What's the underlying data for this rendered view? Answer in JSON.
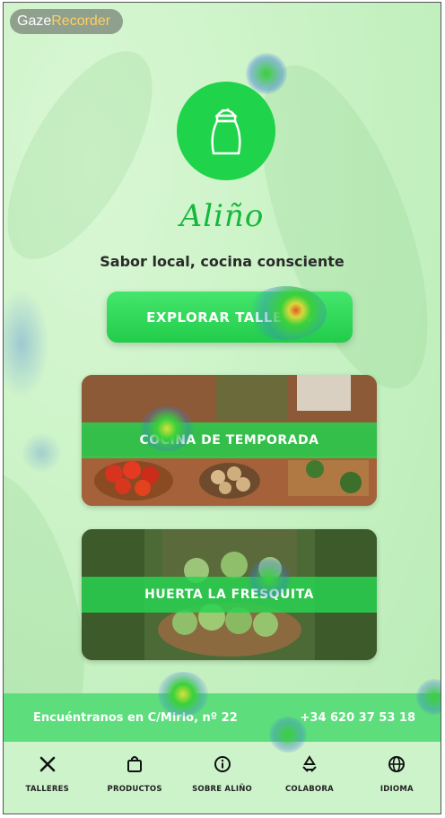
{
  "overlay": {
    "gaze_prefix": "Gaze",
    "gaze_suffix": "Recorder"
  },
  "brand": {
    "name": "Aliño",
    "tagline": "Sabor local, cocina consciente",
    "accent": "#1fd34a"
  },
  "cta": {
    "label": "EXPLORAR TALLERES"
  },
  "cards": [
    {
      "label": "COCINA DE TEMPORADA"
    },
    {
      "label": "HUERTA LA FRESQUITA"
    }
  ],
  "footer": {
    "address": "Encuéntranos en C/Mirlo, nº 22",
    "phone": "+34 620 37 53 18"
  },
  "nav": [
    {
      "label": "TALLERES",
      "icon": "utensils-icon"
    },
    {
      "label": "PRODUCTOS",
      "icon": "shopping-bag-icon"
    },
    {
      "label": "SOBRE ALIÑO",
      "icon": "info-icon"
    },
    {
      "label": "COLABORA",
      "icon": "recycle-icon"
    },
    {
      "label": "IDIOMA",
      "icon": "globe-icon"
    }
  ]
}
